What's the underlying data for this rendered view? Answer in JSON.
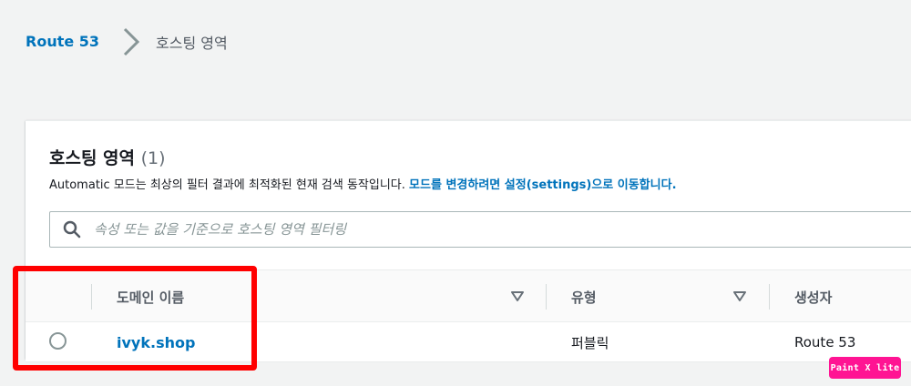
{
  "breadcrumb": {
    "root": "Route 53",
    "current": "호스팅 영역"
  },
  "panel": {
    "title": "호스팅 영역",
    "count": "(1)",
    "description": "Automatic 모드는 최상의 필터 결과에 최적화된 현재 검색 동작입니다. ",
    "settings_link": "모드를 변경하려면 설정(settings)으로 이동합니다."
  },
  "filter": {
    "placeholder": "속성 또는 값을 기준으로 호스팅 영역 필터링"
  },
  "table": {
    "columns": [
      "도메인 이름",
      "유형",
      "생성자"
    ],
    "rows": [
      {
        "domain": "ivyk.shop",
        "type": "퍼블릭",
        "created_by": "Route 53",
        "selected": false
      }
    ]
  },
  "watermark": "Paint X lite",
  "colors": {
    "link": "#0073bb",
    "highlight": "#ff0000",
    "watermark_bg": "#ff1493"
  }
}
